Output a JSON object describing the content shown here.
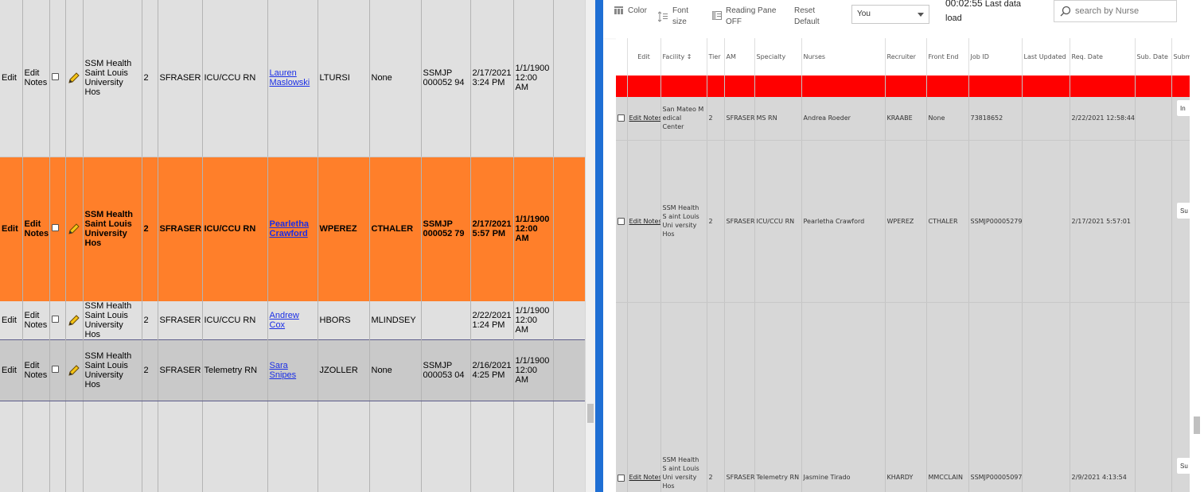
{
  "left": {
    "rows": [
      {
        "edit": "Edit",
        "notes": "Edit Notes",
        "facility": "SSM Health Saint Louis University Hos",
        "tier": "2",
        "am": "SFRASER",
        "specialty": "ICU/CCU RN",
        "nurse": "Lauren Maslowski",
        "recruiter": "LTURSI",
        "frontend": "None",
        "jobid": "SSMJP 000052 94",
        "date": "2/17/2021 3:24 PM",
        "date2": "1/1/1900 12:00 AM"
      },
      {
        "edit": "Edit",
        "notes": "Edit Notes",
        "facility": "SSM Health Saint Louis University Hos",
        "tier": "2",
        "am": "SFRASER",
        "specialty": "ICU/CCU RN",
        "nurse": "Pearletha Crawford",
        "recruiter": "WPEREZ",
        "frontend": "CTHALER",
        "jobid": "SSMJP 000052 79",
        "date": "2/17/2021 5:57 PM",
        "date2": "1/1/1900 12:00 AM"
      },
      {
        "edit": "Edit",
        "notes": "Edit Notes",
        "facility": "SSM Health Saint Louis University Hos",
        "tier": "2",
        "am": "SFRASER",
        "specialty": "ICU/CCU RN",
        "nurse": "Andrew Cox",
        "recruiter": "HBORS",
        "frontend": "MLINDSEY",
        "jobid": "",
        "date": "2/22/2021 1:24 PM",
        "date2": "1/1/1900 12:00 AM"
      },
      {
        "edit": "Edit",
        "notes": "Edit Notes",
        "facility": "SSM Health Saint Louis University Hos",
        "tier": "2",
        "am": "SFRASER",
        "specialty": "Telemetry RN",
        "nurse": "Sara Snipes",
        "recruiter": "JZOLLER",
        "frontend": "None",
        "jobid": "SSMJP 000053 04",
        "date": "2/16/2021 4:25 PM",
        "date2": "1/1/1900 12:00 AM"
      }
    ]
  },
  "toolbar": {
    "color": "Color",
    "font_size": "Font size",
    "reading_pane": "Reading Pane OFF",
    "reset_default": "Reset Default",
    "user_select": "You",
    "timer": "00:02:55",
    "last_load": "Last data load",
    "search_placeholder": "search by Nurse"
  },
  "grid": {
    "headers": [
      "Edit",
      "Facility ↕",
      "Tier",
      "AM",
      "Specialty",
      "Nurses",
      "Recruiter",
      "Front End",
      "Job ID",
      "Last Updated",
      "Req. Date",
      "Sub. Date",
      "Subm"
    ],
    "rows": [
      {
        "notes": "Edit Notes",
        "facility": "San Mateo M edical Center",
        "tier": "2",
        "am": "SFRASER",
        "specialty": "MS RN",
        "nurse": "Andrea Roeder",
        "recruiter": "KRAABE",
        "frontend": "None",
        "jobid": "73818652",
        "updated": "",
        "reqdate": "2/22/2021 12:58:44",
        "subdate": "",
        "btn": "In"
      },
      {
        "notes": "Edit Notes",
        "facility": "SSM Health S aint Louis Uni versity Hos",
        "tier": "2",
        "am": "SFRASER",
        "specialty": "ICU/CCU RN",
        "nurse": "Pearletha Crawford",
        "recruiter": "WPEREZ",
        "frontend": "CTHALER",
        "jobid": "SSMJP00005279",
        "updated": "",
        "reqdate": "2/17/2021 5:57:01",
        "subdate": "",
        "btn": "Su"
      },
      {
        "notes": "Edit Notes",
        "facility": "SSM Health S aint Louis Uni versity Hos",
        "tier": "2",
        "am": "SFRASER",
        "specialty": "Telemetry RN",
        "nurse": "Jasmine Tirado",
        "recruiter": "KHARDY",
        "frontend": "MMCCLAIN",
        "jobid": "SSMJP00005097",
        "updated": "",
        "reqdate": "2/9/2021 4:13:54",
        "subdate": "",
        "btn": "Su"
      }
    ]
  },
  "colors": {
    "highlight_row": "#ff7f2a",
    "red_row": "#ff0000",
    "divider": "#1f6fd4"
  }
}
